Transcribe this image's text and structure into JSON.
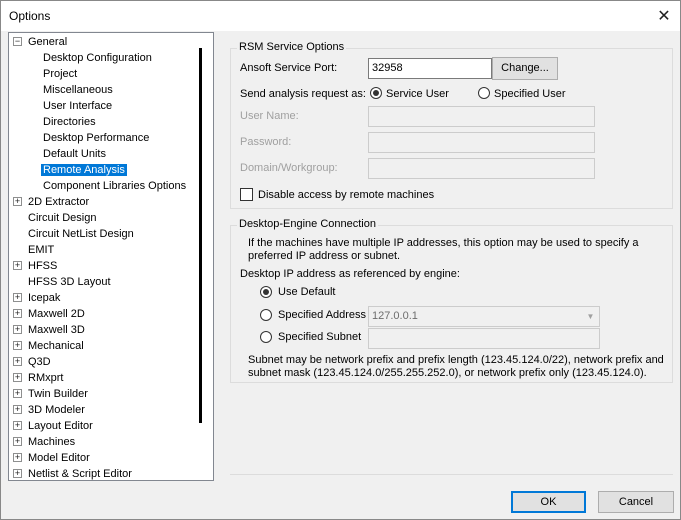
{
  "window": {
    "title": "Options",
    "close_glyph": "✕"
  },
  "tree": {
    "items": [
      {
        "label": "General",
        "expander": "⊟"
      },
      {
        "label": "Desktop Configuration"
      },
      {
        "label": "Project"
      },
      {
        "label": "Miscellaneous"
      },
      {
        "label": "User Interface"
      },
      {
        "label": "Directories"
      },
      {
        "label": "Desktop Performance"
      },
      {
        "label": "Default Units"
      },
      {
        "label": "Remote Analysis",
        "selected": true
      },
      {
        "label": "Component Libraries Options"
      },
      {
        "label": "2D Extractor",
        "expander": "⊞"
      },
      {
        "label": "Circuit Design"
      },
      {
        "label": "Circuit NetList Design"
      },
      {
        "label": "EMIT"
      },
      {
        "label": "HFSS",
        "expander": "⊞"
      },
      {
        "label": "HFSS 3D Layout"
      },
      {
        "label": "Icepak",
        "expander": "⊞"
      },
      {
        "label": "Maxwell 2D",
        "expander": "⊞"
      },
      {
        "label": "Maxwell 3D",
        "expander": "⊞"
      },
      {
        "label": "Mechanical",
        "expander": "⊞"
      },
      {
        "label": "Q3D",
        "expander": "⊞"
      },
      {
        "label": "RMxprt",
        "expander": "⊞"
      },
      {
        "label": "Twin Builder",
        "expander": "⊞"
      },
      {
        "label": "3D Modeler",
        "expander": "⊞"
      },
      {
        "label": "Layout Editor",
        "expander": "⊞"
      },
      {
        "label": "Machines",
        "expander": "⊞"
      },
      {
        "label": "Model Editor",
        "expander": "⊞"
      },
      {
        "label": "Netlist & Script Editor",
        "expander": "⊞"
      }
    ]
  },
  "rsm": {
    "title": "RSM Service Options",
    "port_label": "Ansoft Service Port:",
    "port_value": "32958",
    "change_button": "Change...",
    "send_label": "Send analysis request as:",
    "service_user": "Service User",
    "specified_user": "Specified User",
    "user_name": "User Name:",
    "password": "Password:",
    "domain": "Domain/Workgroup:",
    "disable_remote": "Disable access by remote machines"
  },
  "engine": {
    "title": "Desktop-Engine Connection",
    "info_line1": "If the machines have multiple IP addresses, this option may be used to specify a",
    "info_line2": "preferred IP address or subnet.",
    "ip_label": "Desktop IP address as referenced by engine:",
    "use_default": "Use Default",
    "specified_address": "Specified Address",
    "address_value": "127.0.0.1",
    "specified_subnet": "Specified Subnet",
    "note_line1": "Subnet may be network prefix and prefix length (123.45.124.0/22), network prefix and",
    "note_line2": "subnet mask (123.45.124.0/255.255.252.0), or network prefix only (123.45.124.0)."
  },
  "footer": {
    "ok": "OK",
    "cancel": "Cancel"
  }
}
